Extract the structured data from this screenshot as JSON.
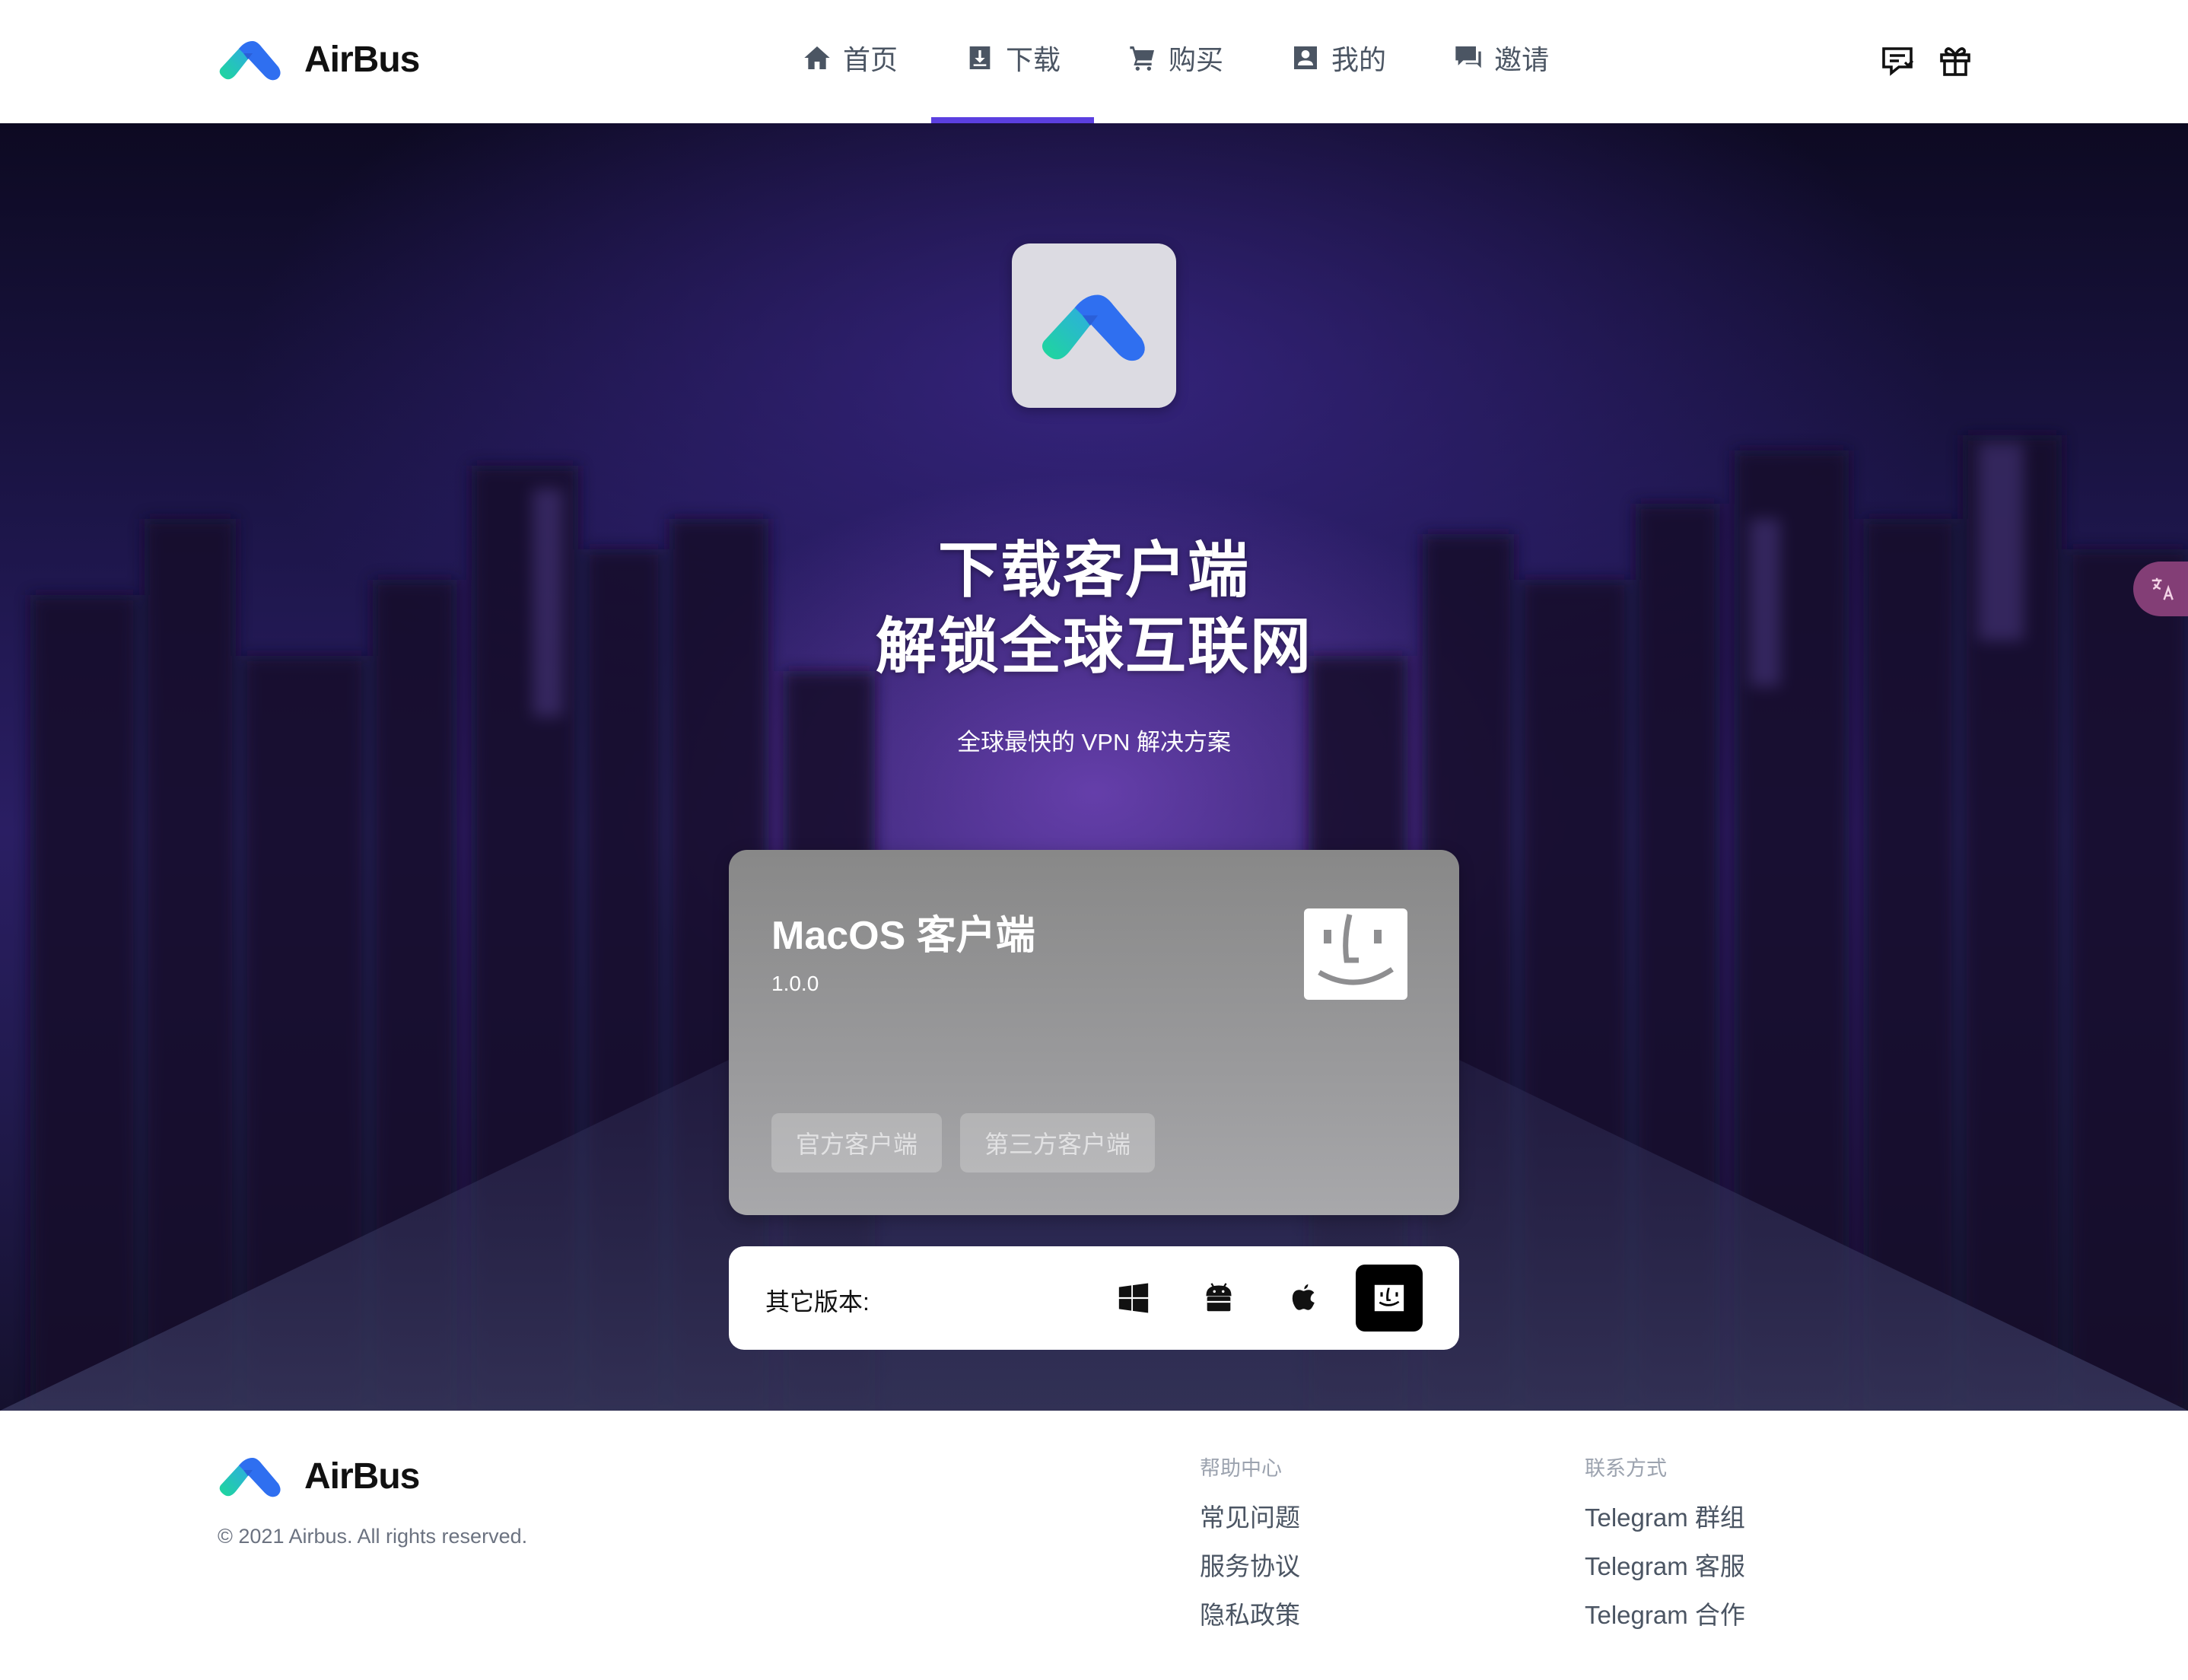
{
  "brand": {
    "name": "AirBus"
  },
  "nav": {
    "items": [
      {
        "label": "首页",
        "icon": "home-icon"
      },
      {
        "label": "下载",
        "icon": "download-icon",
        "active": true
      },
      {
        "label": "购买",
        "icon": "cart-icon"
      },
      {
        "label": "我的",
        "icon": "account-icon"
      },
      {
        "label": "邀请",
        "icon": "invite-icon"
      }
    ],
    "accent_color": "#5b3fe0"
  },
  "header_actions": [
    {
      "icon": "message-icon"
    },
    {
      "icon": "gift-icon"
    }
  ],
  "hero": {
    "title_line1": "下载客户端",
    "title_line2": "解锁全球互联网",
    "subtitle": "全球最快的 VPN 解决方案"
  },
  "client_card": {
    "title": "MacOS 客户端",
    "version": "1.0.0",
    "icon": "finder-icon",
    "buttons": [
      {
        "label": "官方客户端"
      },
      {
        "label": "第三方客户端"
      }
    ]
  },
  "other_versions": {
    "label": "其它版本:",
    "platforms": [
      {
        "icon": "windows-icon",
        "active": false
      },
      {
        "icon": "android-icon",
        "active": false
      },
      {
        "icon": "apple-icon",
        "active": false
      },
      {
        "icon": "finder-icon",
        "active": true
      }
    ]
  },
  "language_toggle": {
    "icon": "translate-icon"
  },
  "footer": {
    "brand": "AirBus",
    "copyright": "© 2021 Airbus. All rights reserved.",
    "columns": [
      {
        "heading": "帮助中心",
        "links": [
          "常见问题",
          "服务协议",
          "隐私政策"
        ]
      },
      {
        "heading": "联系方式",
        "links": [
          "Telegram 群组",
          "Telegram 客服",
          "Telegram 合作"
        ]
      }
    ]
  }
}
